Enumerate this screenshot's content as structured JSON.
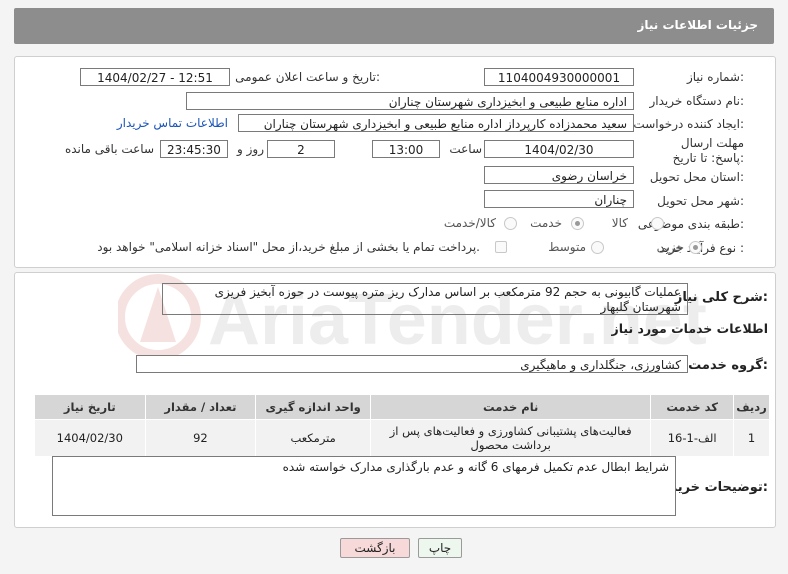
{
  "header": {
    "title": "جزئیات اطلاعات نیاز"
  },
  "fields": {
    "need_number": {
      "label": "شماره نیاز:",
      "value": "1104004930000001"
    },
    "announce": {
      "label": "تاریخ و ساعت اعلان عمومی:",
      "value": "1404/02/27 - 12:51"
    },
    "buyer_org": {
      "label": "نام دستگاه خریدار:",
      "value": "اداره منابع طبیعی و ابخیزداری شهرستان چناران"
    },
    "creator": {
      "label": "ایجاد کننده درخواست:",
      "value": "سعید محمدزاده کارپرداز اداره منابع طبیعی و ابخیزداری شهرستان چناران",
      "contact_link": "اطلاعات تماس خریدار"
    },
    "deadline": {
      "label": "مهلت ارسال پاسخ: تا تاریخ:",
      "date": "1404/02/30",
      "time_label": "ساعت",
      "time": "13:00",
      "days": "2",
      "days_label": "روز و",
      "remaining": "23:45:30",
      "remaining_label": "ساعت باقی مانده"
    },
    "province": {
      "label": "استان محل تحویل:",
      "value": "خراسان رضوی"
    },
    "city": {
      "label": "شهر محل تحویل:",
      "value": "چناران"
    },
    "category": {
      "label": "طبقه بندی موضوعی:",
      "options": [
        "کالا",
        "خدمت",
        "کالا/خدمت"
      ],
      "selected": "خدمت"
    },
    "purchase_type": {
      "label": "نوع فرآیند خرید :",
      "options": [
        "جزیی",
        "متوسط"
      ],
      "selected": "جزیی",
      "note": "پرداخت تمام یا بخشی از مبلغ خرید،از محل \"اسناد خزانه اسلامی\" خواهد بود."
    }
  },
  "description": {
    "label": "شرح کلی نیاز:",
    "value": "عملیات گابیونی به حجم 92 مترمکعب بر اساس مدارک  ریز متره پیوست  در حوزه آبخیز فریزی شهرستان گلبهار"
  },
  "services": {
    "section_title": "اطلاعات خدمات مورد نیاز",
    "group_label": "گروه خدمت:",
    "group_value": "کشاورزی، جنگلداری و ماهیگیری",
    "columns": [
      "ردیف",
      "کد خدمت",
      "نام خدمت",
      "واحد اندازه گیری",
      "تعداد / مقدار",
      "تاریخ نیاز"
    ],
    "rows": [
      [
        "1",
        "الف-1-16",
        "فعالیت‌های پشتیبانی کشاورزی و فعالیت‌های پس از برداشت محصول",
        "مترمکعب",
        "92",
        "1404/02/30"
      ]
    ]
  },
  "buyer_notes": {
    "label": "توضیحات خریدار:",
    "value": "شرایط ابطال  عدم تکمیل فرمهای 6 گانه و عدم بارگذاری مدارک خواسته شده"
  },
  "buttons": {
    "print": "چاپ",
    "back": "بازگشت"
  },
  "watermark": {
    "text": "AriaTender.net"
  },
  "colors": {
    "header_bg": "#8d8d8d",
    "link": "#1a55b8",
    "back_button_bg": "#f7d9d9",
    "print_button_bg": "#eef7ee"
  }
}
